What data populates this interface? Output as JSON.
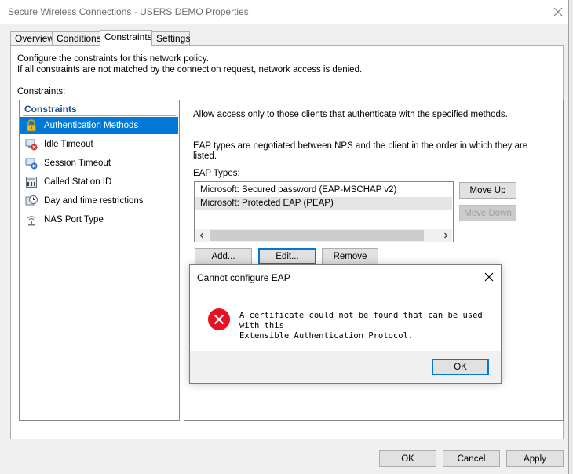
{
  "window": {
    "title": "Secure Wireless Connections - USERS DEMO Properties"
  },
  "tabs": [
    {
      "label": "Overview"
    },
    {
      "label": "Conditions"
    },
    {
      "label": "Constraints"
    },
    {
      "label": "Settings"
    }
  ],
  "constraints_page": {
    "description_line1": "Configure the constraints for this network policy.",
    "description_line2": "If all constraints are not matched by the connection request, network access is denied.",
    "constraints_label": "Constraints:",
    "list_header": "Constraints",
    "items": [
      {
        "label": "Authentication Methods",
        "icon": "lock-icon"
      },
      {
        "label": "Idle Timeout",
        "icon": "idle-timeout-icon"
      },
      {
        "label": "Session Timeout",
        "icon": "session-timeout-icon"
      },
      {
        "label": "Called Station ID",
        "icon": "calculator-icon"
      },
      {
        "label": "Day and time restrictions",
        "icon": "clock-icon"
      },
      {
        "label": "NAS Port Type",
        "icon": "network-icon"
      }
    ]
  },
  "auth_methods": {
    "intro": "Allow access only to those clients that authenticate with the specified methods.",
    "eap_note_line1": "EAP types are negotiated between NPS and the client in the order in which they are",
    "eap_note_line2": "listed.",
    "eap_types_label": "EAP Types:",
    "eap_types": [
      "Microsoft: Secured password (EAP-MSCHAP v2)",
      "Microsoft: Protected EAP (PEAP)"
    ],
    "move_up": "Move Up",
    "move_down": "Move Down",
    "add": "Add...",
    "edit": "Edit...",
    "remove": "Remove"
  },
  "dialog": {
    "title": "Cannot configure EAP",
    "message_line1": "A certificate could not be found that can be used with this",
    "message_line2": "Extensible Authentication Protocol.",
    "ok": "OK"
  },
  "footer": {
    "ok": "OK",
    "cancel": "Cancel",
    "apply": "Apply"
  },
  "colors": {
    "selection": "#0078d7",
    "error": "#e81123"
  }
}
